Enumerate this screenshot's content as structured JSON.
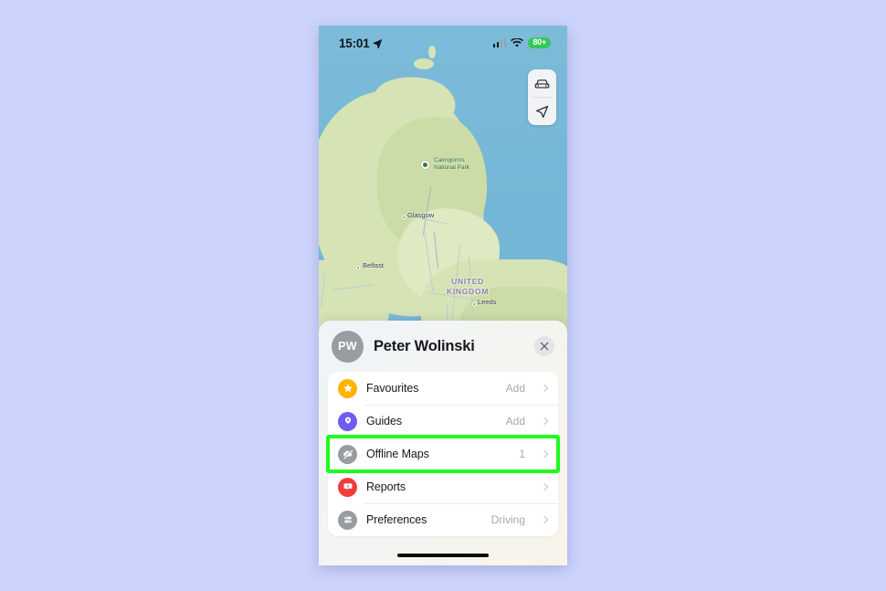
{
  "statusbar": {
    "time": "15:01",
    "location_icon": "location-arrow-icon",
    "signal_icon": "cellular-signal-icon",
    "wifi_icon": "wifi-icon",
    "battery_label": "80+"
  },
  "map": {
    "controls": [
      {
        "name": "driving-mode-button",
        "icon": "car-icon"
      },
      {
        "name": "locate-me-button",
        "icon": "navigation-arrow-icon"
      }
    ],
    "labels": {
      "park": "Cairngorms",
      "park_line2": "National Park",
      "glasgow": "Glasgow",
      "belfast": "Belfast",
      "leeds": "Leeds",
      "country_line1": "UNITED",
      "country_line2": "KINGDOM"
    }
  },
  "sheet": {
    "avatar_initials": "PW",
    "user_name": "Peter Wolinski",
    "close_label": "Close",
    "menu": [
      {
        "label": "Favourites",
        "value": "Add",
        "icon": "star-icon",
        "color": "#ffb400",
        "highlighted": false
      },
      {
        "label": "Guides",
        "value": "Add",
        "icon": "guides-pin-icon",
        "color": "#6d5ef0",
        "highlighted": false
      },
      {
        "label": "Offline Maps",
        "value": "1",
        "icon": "offline-maps-icon",
        "color": "#9a9ca3",
        "highlighted": true
      },
      {
        "label": "Reports",
        "value": "",
        "icon": "report-alert-icon",
        "color": "#f03c3c",
        "highlighted": false
      },
      {
        "label": "Preferences",
        "value": "Driving",
        "icon": "preferences-icon",
        "color": "#9a9ca3",
        "highlighted": false
      }
    ]
  },
  "theme": {
    "highlight_color": "#1dfc1d",
    "page_background": "#ccd4fc",
    "battery_green": "#34c759"
  }
}
